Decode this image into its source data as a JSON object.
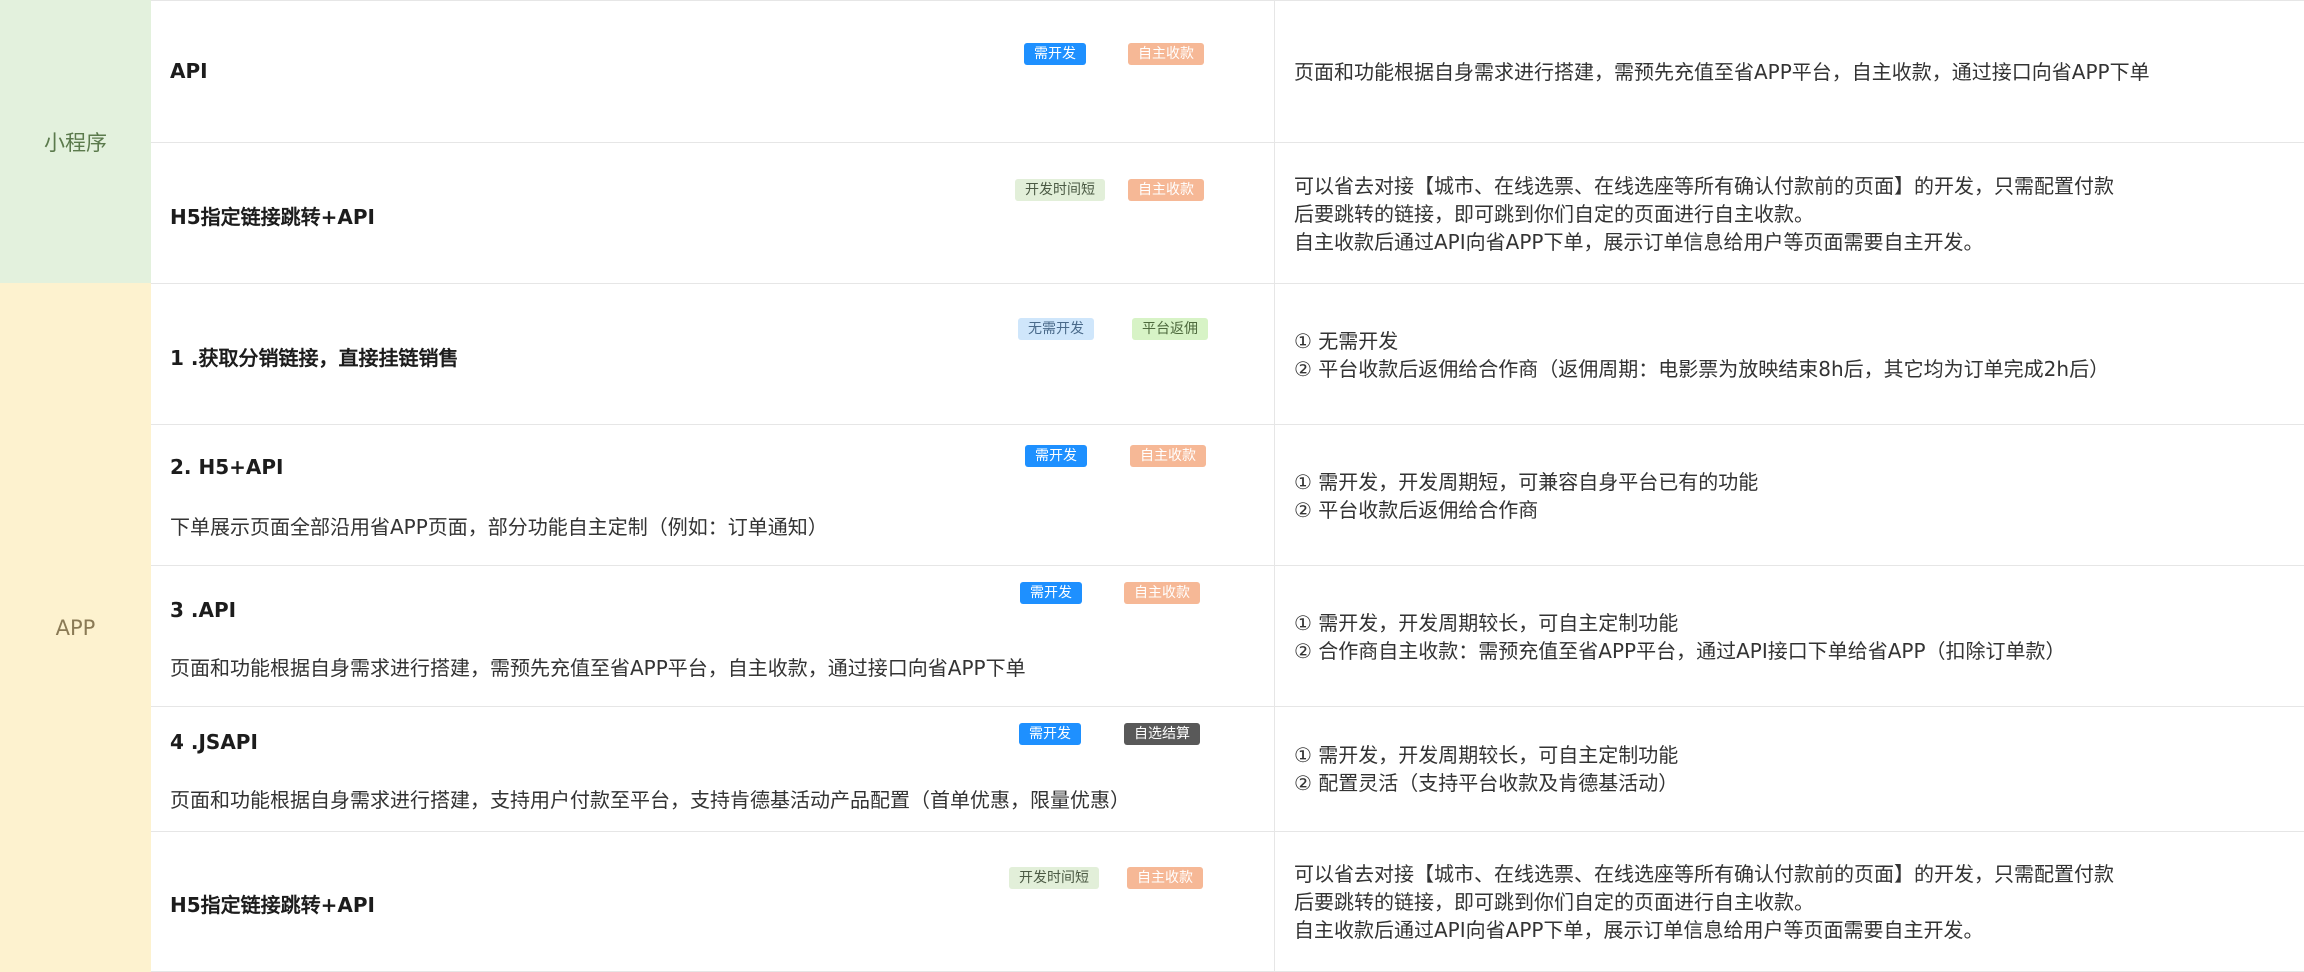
{
  "groups": {
    "mini_program": "小程序",
    "app": "APP"
  },
  "tags": {
    "need_dev": "需开发",
    "self_collect": "自主收款",
    "short_dev": "开发时间短",
    "no_dev": "无需开发",
    "platform_rebate": "平台返佣",
    "self_settle": "自选结算"
  },
  "rows": [
    {
      "title": "API",
      "subtitle": "",
      "desc": [
        "页面和功能根据自身需求进行搭建，需预先充值至省APP平台，自主收款，通过接口向省APP下单"
      ]
    },
    {
      "title": "H5指定链接跳转+API",
      "subtitle": "",
      "desc": [
        "可以省去对接【城市、在线选票、在线选座等所有确认付款前的页面】的开发，只需配置付款",
        "后要跳转的链接，即可跳到你们自定的页面进行自主收款。",
        "自主收款后通过API向省APP下单，展示订单信息给用户等页面需要自主开发。"
      ]
    },
    {
      "title": "1 .获取分销链接，直接挂链销售",
      "subtitle": "",
      "desc": [
        "① 无需开发",
        "② 平台收款后返佣给合作商（返佣周期：电影票为放映结束8h后，其它均为订单完成2h后）"
      ]
    },
    {
      "title": "2. H5+API",
      "subtitle": "下单展示页面全部沿用省APP页面，部分功能自主定制（例如：订单通知）",
      "desc": [
        "① 需开发，开发周期短，可兼容自身平台已有的功能",
        "② 平台收款后返佣给合作商"
      ]
    },
    {
      "title": "3 .API",
      "subtitle": "页面和功能根据自身需求进行搭建，需预先充值至省APP平台，自主收款，通过接口向省APP下单",
      "desc": [
        "① 需开发，开发周期较长，可自主定制功能",
        "② 合作商自主收款：需预充值至省APP平台，通过API接口下单给省APP（扣除订单款）"
      ]
    },
    {
      "title": "4 .JSAPI",
      "subtitle": "页面和功能根据自身需求进行搭建，支持用户付款至平台，支持肯德基活动产品配置（首单优惠，限量优惠）",
      "desc": [
        "① 需开发，开发周期较长，可自主定制功能",
        "② 配置灵活（支持平台收款及肯德基活动）"
      ]
    },
    {
      "title": "H5指定链接跳转+API",
      "subtitle": "",
      "desc": [
        "可以省去对接【城市、在线选票、在线选座等所有确认付款前的页面】的开发，只需配置付款",
        "后要跳转的链接，即可跳到你们自定的页面进行自主收款。",
        "自主收款后通过API向省APP下单，展示订单信息给用户等页面需要自主开发。"
      ]
    }
  ]
}
